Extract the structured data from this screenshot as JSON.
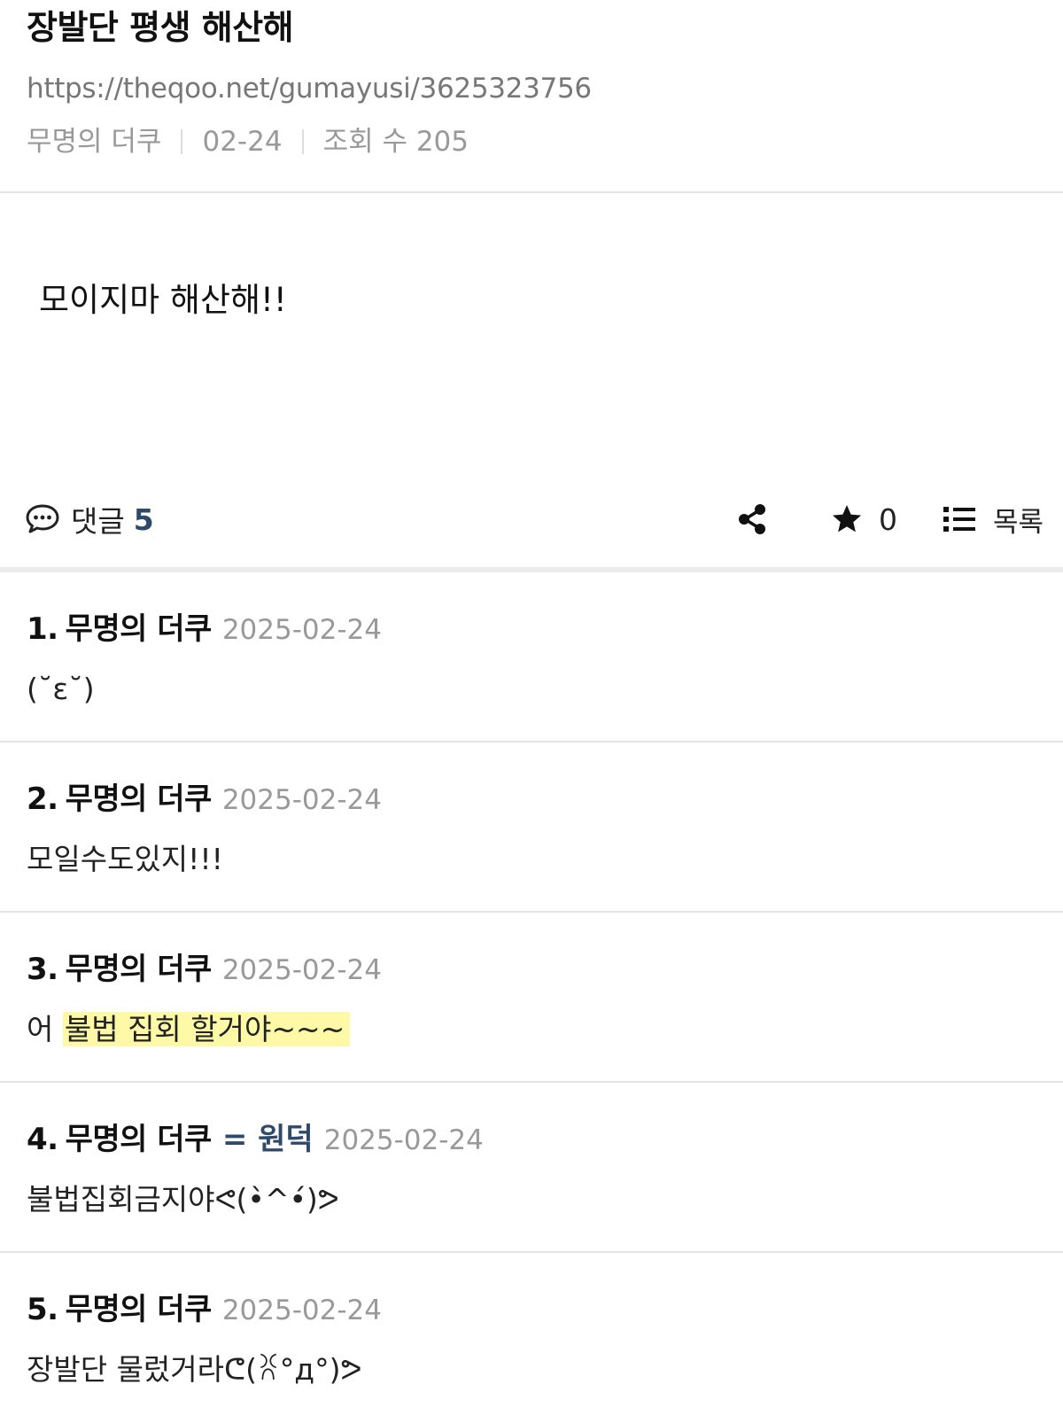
{
  "post": {
    "title": "장발단 평생 해산해",
    "url": "https://theqoo.net/gumayusi/3625323756",
    "author": "무명의 더쿠",
    "date": "02-24",
    "views": "조회 수 205",
    "body": "모이지마 해산해!!"
  },
  "actions": {
    "comment_label": "댓글",
    "comment_count": "5",
    "star_count": "0",
    "list_label": "목록"
  },
  "comments": [
    {
      "num": "1.",
      "author": "무명의 더쿠",
      "origin": "",
      "date": "2025-02-24",
      "text": "(˘ε˘)"
    },
    {
      "num": "2.",
      "author": "무명의 더쿠",
      "origin": "",
      "date": "2025-02-24",
      "text": "모일수도있지!!!"
    },
    {
      "num": "3.",
      "author": "무명의 더쿠",
      "origin": "",
      "date": "2025-02-24",
      "text_plain": "어 ",
      "text_highlight": "불법 집회 할거야~~~"
    },
    {
      "num": "4.",
      "author": "무명의 더쿠",
      "origin": "= 원덕",
      "date": "2025-02-24",
      "text": "불법집회금지야ᕙ(•̀^•́)ᕗ"
    },
    {
      "num": "5.",
      "author": "무명의 더쿠",
      "origin": "",
      "date": "2025-02-24",
      "text": "장발단 물렀거라ᕦ(ꐦ°д°)ᕗ"
    }
  ],
  "colors": {
    "accent": "#2e4a6b",
    "meta_gray": "#999999",
    "highlight": "#fdf9a6"
  }
}
